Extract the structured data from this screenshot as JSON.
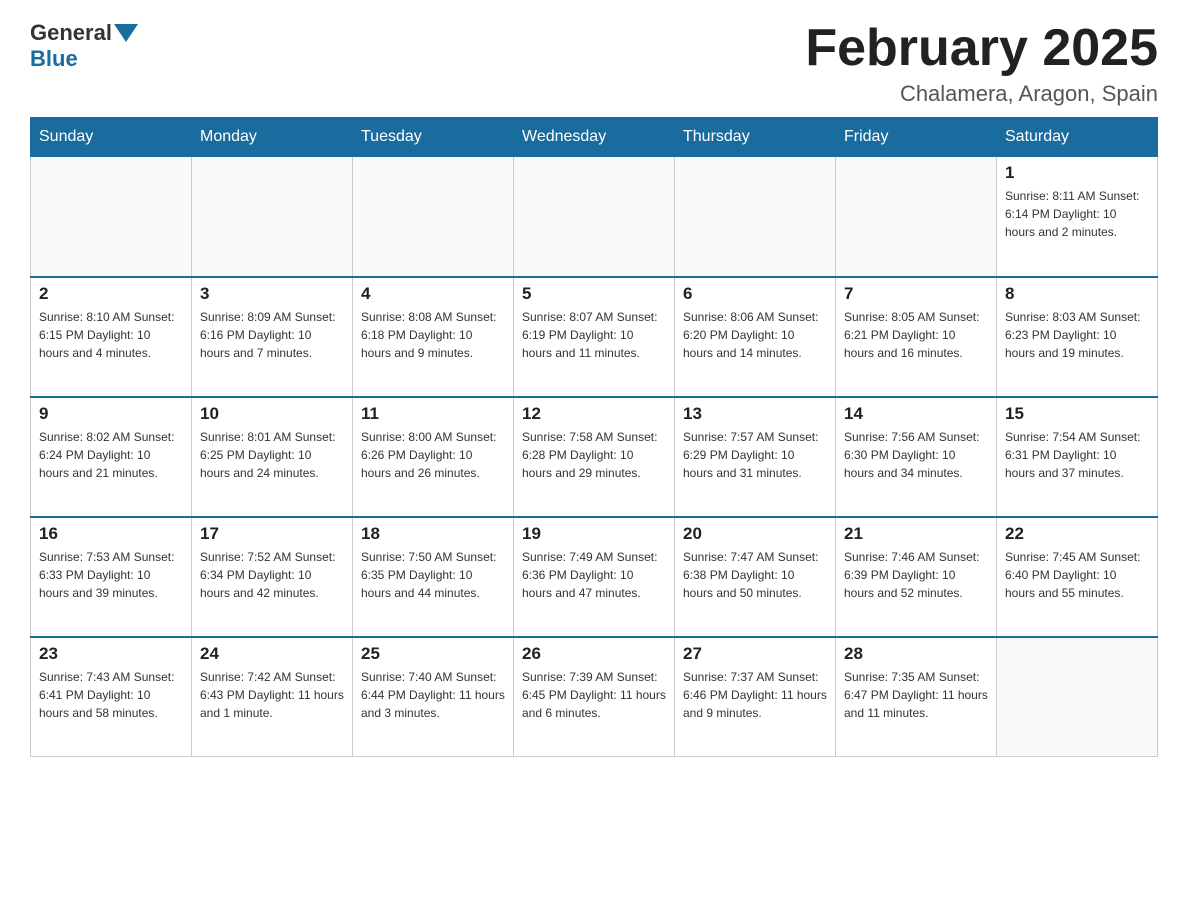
{
  "header": {
    "logo_general": "General",
    "logo_blue": "Blue",
    "month_title": "February 2025",
    "location": "Chalamera, Aragon, Spain"
  },
  "weekdays": [
    "Sunday",
    "Monday",
    "Tuesday",
    "Wednesday",
    "Thursday",
    "Friday",
    "Saturday"
  ],
  "weeks": [
    [
      {
        "day": "",
        "info": ""
      },
      {
        "day": "",
        "info": ""
      },
      {
        "day": "",
        "info": ""
      },
      {
        "day": "",
        "info": ""
      },
      {
        "day": "",
        "info": ""
      },
      {
        "day": "",
        "info": ""
      },
      {
        "day": "1",
        "info": "Sunrise: 8:11 AM\nSunset: 6:14 PM\nDaylight: 10 hours and 2 minutes."
      }
    ],
    [
      {
        "day": "2",
        "info": "Sunrise: 8:10 AM\nSunset: 6:15 PM\nDaylight: 10 hours and 4 minutes."
      },
      {
        "day": "3",
        "info": "Sunrise: 8:09 AM\nSunset: 6:16 PM\nDaylight: 10 hours and 7 minutes."
      },
      {
        "day": "4",
        "info": "Sunrise: 8:08 AM\nSunset: 6:18 PM\nDaylight: 10 hours and 9 minutes."
      },
      {
        "day": "5",
        "info": "Sunrise: 8:07 AM\nSunset: 6:19 PM\nDaylight: 10 hours and 11 minutes."
      },
      {
        "day": "6",
        "info": "Sunrise: 8:06 AM\nSunset: 6:20 PM\nDaylight: 10 hours and 14 minutes."
      },
      {
        "day": "7",
        "info": "Sunrise: 8:05 AM\nSunset: 6:21 PM\nDaylight: 10 hours and 16 minutes."
      },
      {
        "day": "8",
        "info": "Sunrise: 8:03 AM\nSunset: 6:23 PM\nDaylight: 10 hours and 19 minutes."
      }
    ],
    [
      {
        "day": "9",
        "info": "Sunrise: 8:02 AM\nSunset: 6:24 PM\nDaylight: 10 hours and 21 minutes."
      },
      {
        "day": "10",
        "info": "Sunrise: 8:01 AM\nSunset: 6:25 PM\nDaylight: 10 hours and 24 minutes."
      },
      {
        "day": "11",
        "info": "Sunrise: 8:00 AM\nSunset: 6:26 PM\nDaylight: 10 hours and 26 minutes."
      },
      {
        "day": "12",
        "info": "Sunrise: 7:58 AM\nSunset: 6:28 PM\nDaylight: 10 hours and 29 minutes."
      },
      {
        "day": "13",
        "info": "Sunrise: 7:57 AM\nSunset: 6:29 PM\nDaylight: 10 hours and 31 minutes."
      },
      {
        "day": "14",
        "info": "Sunrise: 7:56 AM\nSunset: 6:30 PM\nDaylight: 10 hours and 34 minutes."
      },
      {
        "day": "15",
        "info": "Sunrise: 7:54 AM\nSunset: 6:31 PM\nDaylight: 10 hours and 37 minutes."
      }
    ],
    [
      {
        "day": "16",
        "info": "Sunrise: 7:53 AM\nSunset: 6:33 PM\nDaylight: 10 hours and 39 minutes."
      },
      {
        "day": "17",
        "info": "Sunrise: 7:52 AM\nSunset: 6:34 PM\nDaylight: 10 hours and 42 minutes."
      },
      {
        "day": "18",
        "info": "Sunrise: 7:50 AM\nSunset: 6:35 PM\nDaylight: 10 hours and 44 minutes."
      },
      {
        "day": "19",
        "info": "Sunrise: 7:49 AM\nSunset: 6:36 PM\nDaylight: 10 hours and 47 minutes."
      },
      {
        "day": "20",
        "info": "Sunrise: 7:47 AM\nSunset: 6:38 PM\nDaylight: 10 hours and 50 minutes."
      },
      {
        "day": "21",
        "info": "Sunrise: 7:46 AM\nSunset: 6:39 PM\nDaylight: 10 hours and 52 minutes."
      },
      {
        "day": "22",
        "info": "Sunrise: 7:45 AM\nSunset: 6:40 PM\nDaylight: 10 hours and 55 minutes."
      }
    ],
    [
      {
        "day": "23",
        "info": "Sunrise: 7:43 AM\nSunset: 6:41 PM\nDaylight: 10 hours and 58 minutes."
      },
      {
        "day": "24",
        "info": "Sunrise: 7:42 AM\nSunset: 6:43 PM\nDaylight: 11 hours and 1 minute."
      },
      {
        "day": "25",
        "info": "Sunrise: 7:40 AM\nSunset: 6:44 PM\nDaylight: 11 hours and 3 minutes."
      },
      {
        "day": "26",
        "info": "Sunrise: 7:39 AM\nSunset: 6:45 PM\nDaylight: 11 hours and 6 minutes."
      },
      {
        "day": "27",
        "info": "Sunrise: 7:37 AM\nSunset: 6:46 PM\nDaylight: 11 hours and 9 minutes."
      },
      {
        "day": "28",
        "info": "Sunrise: 7:35 AM\nSunset: 6:47 PM\nDaylight: 11 hours and 11 minutes."
      },
      {
        "day": "",
        "info": ""
      }
    ]
  ]
}
